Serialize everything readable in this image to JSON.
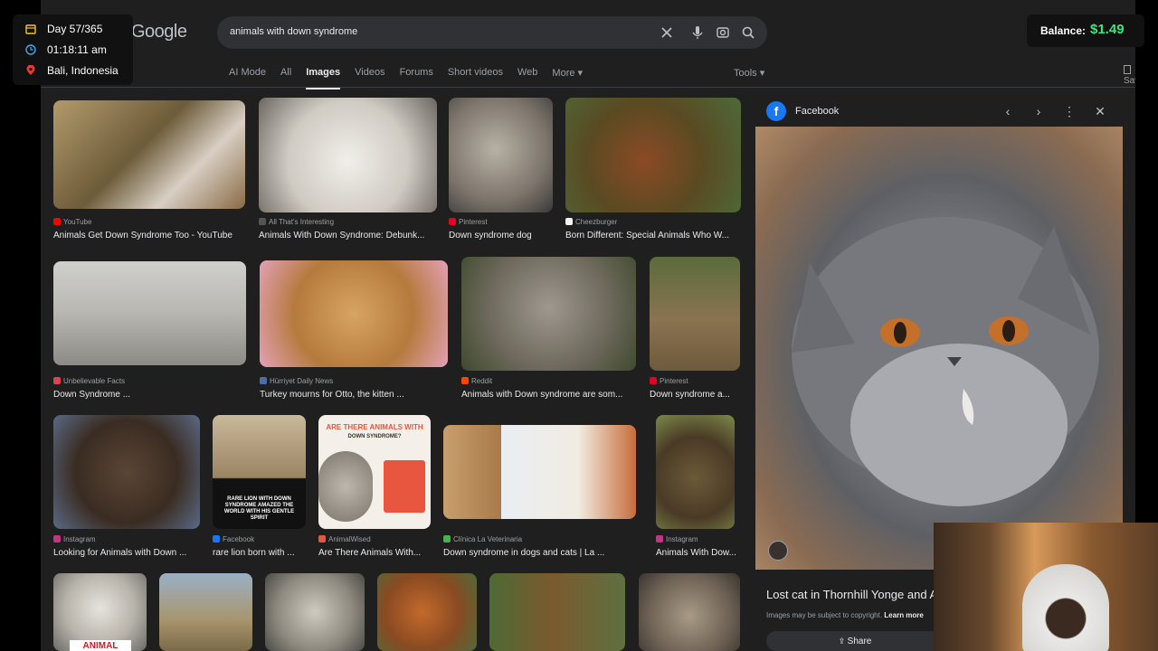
{
  "search": {
    "logo_text": "Google",
    "query": "animals with down syndrome",
    "icons": [
      "clear-icon",
      "mic-icon",
      "lens-icon",
      "search-icon"
    ]
  },
  "tabs": [
    {
      "label": "AI Mode",
      "active": false
    },
    {
      "label": "All",
      "active": false
    },
    {
      "label": "Images",
      "active": true
    },
    {
      "label": "Videos",
      "active": false
    },
    {
      "label": "Forums",
      "active": false
    },
    {
      "label": "Short videos",
      "active": false
    },
    {
      "label": "Web",
      "active": false
    },
    {
      "label": "More ▾",
      "active": false
    }
  ],
  "toolbar": {
    "tools_label": "Tools ▾",
    "saves_label": "Saves"
  },
  "results": [
    {
      "source": "YouTube",
      "caption": "Animals Get Down Syndrome Too - YouTube",
      "favicon_color": "#ff0000",
      "thumb_color": "#8a7a55"
    },
    {
      "source": "All That's Interesting",
      "caption": "Animals With Down Syndrome: Debunk...",
      "favicon_color": "#555555",
      "thumb_color": "#d9d6cf"
    },
    {
      "source": "Pinterest",
      "caption": "Down syndrome dog",
      "favicon_color": "#e60023",
      "thumb_color": "#8d857a"
    },
    {
      "source": "Cheezburger",
      "caption": "Born Different: Special Animals Who W...",
      "favicon_color": "#f4f4f4",
      "thumb_color": "#6b6a3a"
    },
    {
      "source": "Unbelievable Facts",
      "caption": "Down Syndrome ...",
      "favicon_color": "#e04050",
      "thumb_color": "#a8a8a4"
    },
    {
      "source": "Hürriyet Daily News",
      "caption": "Turkey mourns for Otto, the kitten ...",
      "favicon_color": "#4a6ea8",
      "thumb_color": "#c98d4e"
    },
    {
      "source": "Reddit",
      "caption": "Animals with Down syndrome are som...",
      "favicon_color": "#ff4500",
      "thumb_color": "#6f6a5d"
    },
    {
      "source": "Pinterest",
      "caption": "Down syndrome a...",
      "favicon_color": "#e60023",
      "thumb_color": "#7e6c4c"
    },
    {
      "source": "Instagram",
      "caption": "Looking for Animals with Down ...",
      "favicon_color": "#c13584",
      "thumb_color": "#3d2f26"
    },
    {
      "source": "Facebook",
      "caption": "rare lion born with ...",
      "favicon_color": "#1877f2",
      "thumb_color": "#8c7a5e"
    },
    {
      "source": "AnimalWised",
      "caption": "Are There Animals With...",
      "favicon_color": "#e0584a",
      "thumb_color": "#f1ece6"
    },
    {
      "source": "Clínica La Veterinaria",
      "caption": "Down syndrome in dogs and cats | La ...",
      "favicon_color": "#4caf50",
      "thumb_color": "#d9cfc0"
    },
    {
      "source": "Instagram",
      "caption": "Animals With Dow...",
      "favicon_color": "#c13584",
      "thumb_color": "#6b5a38"
    },
    {
      "source": "",
      "caption": "",
      "favicon_color": "#000000",
      "thumb_color": "#c9c8c2"
    },
    {
      "source": "",
      "caption": "",
      "favicon_color": "#000000",
      "thumb_color": "#a8956e"
    },
    {
      "source": "",
      "caption": "",
      "favicon_color": "#000000",
      "thumb_color": "#b9b4aa"
    },
    {
      "source": "",
      "caption": "",
      "favicon_color": "#000000",
      "thumb_color": "#b5642c"
    },
    {
      "source": "",
      "caption": "",
      "favicon_color": "#000000",
      "thumb_color": "#5f7040"
    },
    {
      "source": "",
      "caption": "",
      "favicon_color": "#000000",
      "thumb_color": "#9c8f80"
    }
  ],
  "thumb_texts": {
    "animal_banner": "ANIMAL",
    "are_there": "ARE THERE ANIMALS WITH",
    "down_syndrome_q": "DOWN SYNDROME?",
    "rare_lion": "RARE LION WITH DOWN SYNDROME AMAZED THE WORLD WITH HIS GENTLE SPIRIT"
  },
  "panel": {
    "source": "Facebook",
    "title": "Lost cat in Thornhill Yonge and A",
    "note_prefix": "Images may be subject to copyright.",
    "note_link": "Learn more",
    "share_label": "Share",
    "image_color": "#8d8f93"
  },
  "hud": {
    "day": "Day 57/365",
    "time": "01:18:11 am",
    "location": "Bali, Indonesia",
    "icon_colors": {
      "calendar": "#f4c430",
      "clock": "#3fa9f5",
      "pin": "#e53935"
    }
  },
  "balance": {
    "label": "Balance:",
    "value": "$1.49",
    "value_color": "#39e67f"
  }
}
